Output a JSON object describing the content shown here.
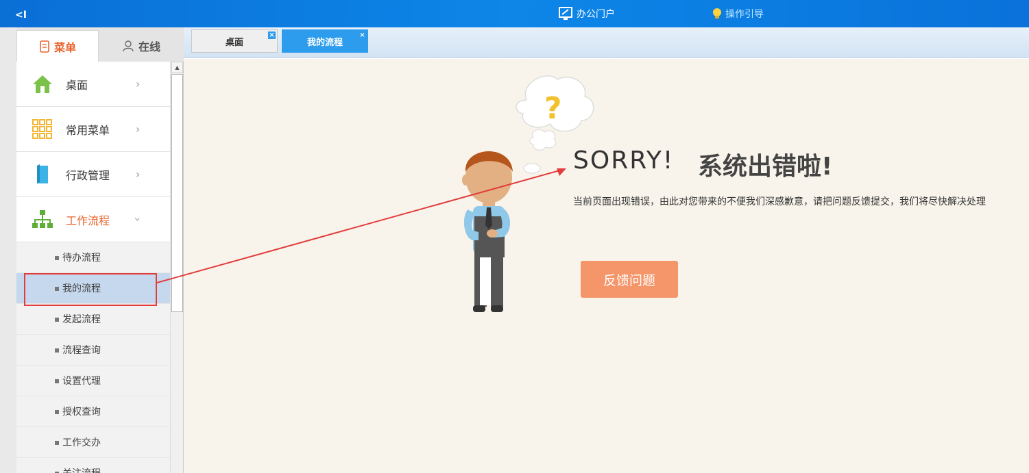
{
  "topbar": {
    "collapse_label": "<I",
    "portal_label": "办公门户",
    "guide_label": "操作引导"
  },
  "sidebar": {
    "tabs": [
      {
        "label": "菜单",
        "icon": "menu-doc-icon",
        "active": true
      },
      {
        "label": "在线",
        "icon": "user-icon",
        "active": false
      }
    ],
    "items": [
      {
        "label": "桌面",
        "icon": "home-icon"
      },
      {
        "label": "常用菜单",
        "icon": "grid-icon"
      },
      {
        "label": "行政管理",
        "icon": "book-icon"
      },
      {
        "label": "工作流程",
        "icon": "org-chart-icon",
        "open": true
      }
    ],
    "sub_items": [
      {
        "label": "待办流程"
      },
      {
        "label": "我的流程",
        "active": true
      },
      {
        "label": "发起流程"
      },
      {
        "label": "流程查询"
      },
      {
        "label": "设置代理"
      },
      {
        "label": "授权查询"
      },
      {
        "label": "工作交办"
      },
      {
        "label": "关注流程"
      }
    ]
  },
  "tabs": [
    {
      "label": "桌面",
      "active": false
    },
    {
      "label": "我的流程",
      "active": true
    }
  ],
  "error": {
    "title": "SORRY!",
    "title_cn": "系统出错啦!",
    "question_mark": "?",
    "message": "当前页面出现错误，由此对您带来的不便我们深感歉意，请把问题反馈提交，我们将尽快解决处理",
    "feedback_button": "反馈问题"
  },
  "colors": {
    "topbar": "#0d86e8",
    "accent_orange": "#e8632b",
    "active_tab": "#2d9cec",
    "feedback_button": "#f5956a",
    "content_bg": "#f8f4eb",
    "annotation_red": "#e23c3c"
  }
}
